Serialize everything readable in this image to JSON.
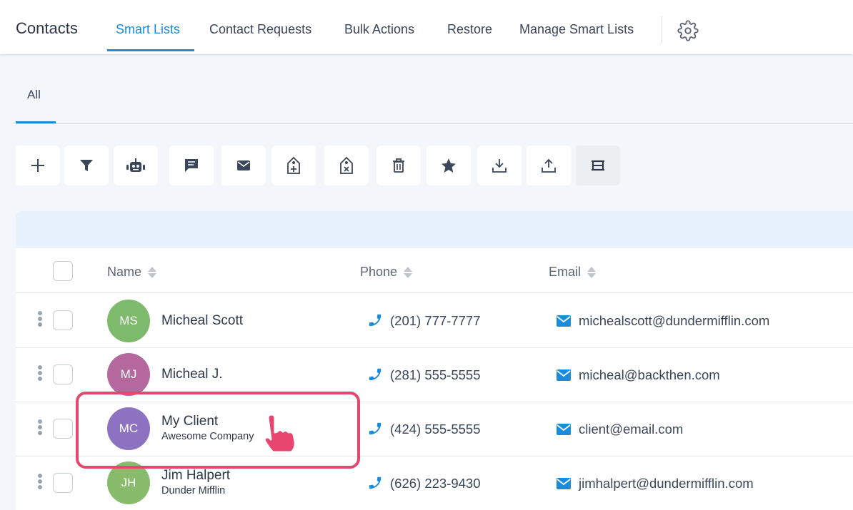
{
  "topnav": {
    "title": "Contacts",
    "tabs": [
      {
        "label": "Smart Lists",
        "active": true
      },
      {
        "label": "Contact Requests",
        "active": false
      },
      {
        "label": "Bulk Actions",
        "active": false
      },
      {
        "label": "Restore",
        "active": false
      },
      {
        "label": "Manage Smart Lists",
        "active": false
      }
    ],
    "settings_icon": "gear-icon"
  },
  "subtabs": [
    {
      "label": "All",
      "active": true
    }
  ],
  "toolbar": {
    "buttons": [
      {
        "icon": "plus-icon"
      },
      {
        "icon": "filter-icon"
      },
      {
        "icon": "robot-icon"
      },
      {
        "icon": "message-icon"
      },
      {
        "icon": "envelope-icon"
      },
      {
        "icon": "add-tag-icon"
      },
      {
        "icon": "remove-tag-icon"
      },
      {
        "icon": "trash-icon"
      },
      {
        "icon": "star-icon"
      },
      {
        "icon": "import-icon"
      },
      {
        "icon": "export-icon"
      },
      {
        "icon": "column-settings-icon",
        "pressed": true
      }
    ]
  },
  "table": {
    "columns": [
      "Name",
      "Phone",
      "Email"
    ],
    "rows": [
      {
        "initials": "MS",
        "avatar_color": "#7dba6c",
        "name": "Micheal Scott",
        "company": "",
        "phone": "(201) 777-7777",
        "email": "michealscott@dundermifflin.com"
      },
      {
        "initials": "MJ",
        "avatar_color": "#b5689e",
        "name": "Micheal J.",
        "company": "",
        "phone": "(281) 555-5555",
        "email": "micheal@backthen.com"
      },
      {
        "initials": "MC",
        "avatar_color": "#8d72c2",
        "name": "My Client",
        "company": "Awesome Company",
        "phone": "(424) 555-5555",
        "email": "client@email.com",
        "highlighted": true
      },
      {
        "initials": "JH",
        "avatar_color": "#88bb6b",
        "name": "Jim Halpert",
        "company": "Dunder Mifflin",
        "phone": "(626) 223-9430",
        "email": "jimhalpert@dundermifflin.com"
      }
    ]
  },
  "colors": {
    "accent": "#1a8cde",
    "highlight": "#e8466e"
  }
}
